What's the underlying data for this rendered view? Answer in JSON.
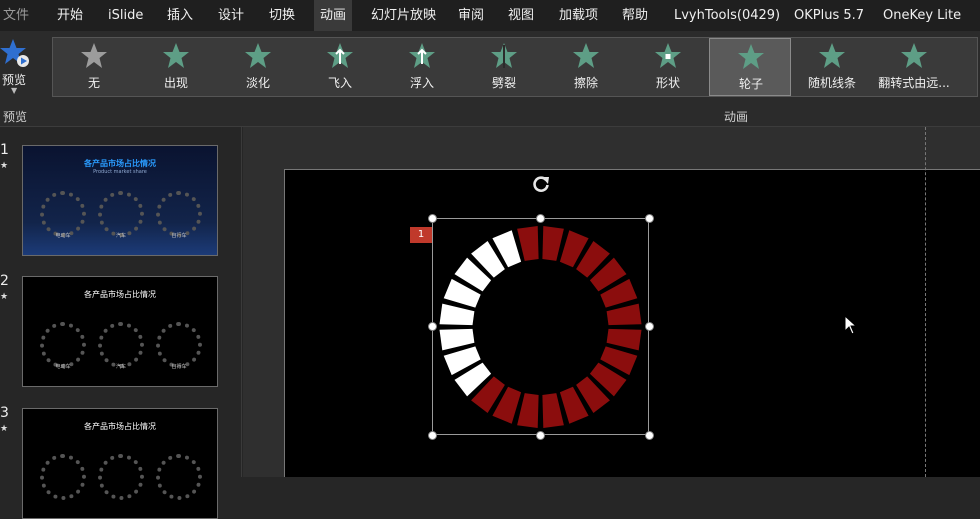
{
  "menubar": {
    "tabs": [
      "文件",
      "开始",
      "iSlide",
      "插入",
      "设计",
      "切换",
      "动画",
      "幻灯片放映",
      "审阅",
      "视图",
      "加载项",
      "帮助",
      "LvyhTools(0429)",
      "OKPlus 5.7",
      "OneKey Lite"
    ],
    "active_tab": "动画"
  },
  "ribbon": {
    "preview_label": "预览",
    "preview_group_label": "预览",
    "animation_group_label": "动画",
    "effects": [
      {
        "label": "无",
        "icon": "star-none-icon"
      },
      {
        "label": "出现",
        "icon": "star-appear-icon"
      },
      {
        "label": "淡化",
        "icon": "star-fade-icon"
      },
      {
        "label": "飞入",
        "icon": "star-fly-in-icon"
      },
      {
        "label": "浮入",
        "icon": "star-float-in-icon"
      },
      {
        "label": "劈裂",
        "icon": "star-split-icon"
      },
      {
        "label": "擦除",
        "icon": "star-wipe-icon"
      },
      {
        "label": "形状",
        "icon": "star-shape-icon"
      },
      {
        "label": "轮子",
        "icon": "star-wheel-icon"
      },
      {
        "label": "随机线条",
        "icon": "star-random-bars-icon"
      },
      {
        "label": "翻转式由远...",
        "icon": "star-grow-turn-icon"
      }
    ],
    "selected_effect": "轮子"
  },
  "slides": [
    {
      "number": "1",
      "title": "各产品市场占比情况",
      "subtitle": "Product market share",
      "gauges": [
        "电动车",
        "汽车",
        "自行车"
      ]
    },
    {
      "number": "2",
      "title": "各产品市场占比情况",
      "subtitle": "",
      "gauges": [
        "电动车",
        "汽车",
        "自行车"
      ]
    },
    {
      "number": "3",
      "title": "各产品市场占比情况",
      "subtitle": "",
      "gauges": []
    }
  ],
  "canvas": {
    "animation_badge": "1",
    "donut": {
      "segments_total": 24,
      "filled_segments": 16,
      "filled_color": "#8b0d0d",
      "empty_color": "#ffffff"
    }
  },
  "colors": {
    "accent_star": "#5e9e86",
    "badge": "#c0392b"
  }
}
